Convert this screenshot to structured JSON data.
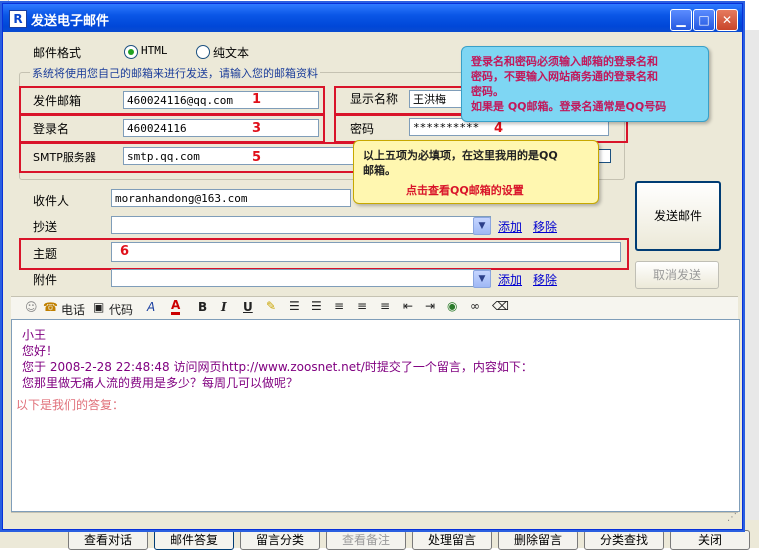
{
  "window": {
    "title": "发送电子邮件",
    "app_icon": "R",
    "controls": [
      "minimize-icon",
      "maximize-icon",
      "close-icon"
    ]
  },
  "format": {
    "label": "邮件格式",
    "option_html": "HTML",
    "option_text": "纯文本",
    "selected": "HTML"
  },
  "group_title": "系统将使用您自己的邮箱来进行发送，请输入您的邮箱资料",
  "fields": {
    "sender_label": "发件邮箱",
    "sender_value": "460024116@qq.com",
    "login_label": "登录名",
    "login_value": "460024116",
    "smtp_label": "SMTP服务器",
    "smtp_value": "smtp.qq.com",
    "display_label": "显示名称",
    "display_value": "王洪梅",
    "password_label": "密码",
    "password_value": "**********"
  },
  "numbers": [
    "1",
    "2",
    "3",
    "4",
    "5",
    "6"
  ],
  "recipients": {
    "to_label": "收件人",
    "to_value": "moranhandong@163.com",
    "cc_label": "抄送",
    "subject_label": "主题",
    "attach_label": "附件",
    "add_link": "添加",
    "remove_link": "移除"
  },
  "buttons": {
    "send": "发送邮件",
    "cancel": "取消发送"
  },
  "tooltip_blue": {
    "line1": "登录名和密码必须输入邮箱的登录名和",
    "line2": "密码，不要输入网站商务通的登录名和",
    "line3": "密码。",
    "line4": "如果是 QQ邮箱。登录名通常是QQ号码"
  },
  "tooltip_yellow": {
    "line1": "以上五项为必填项，在这里我用的是QQ",
    "line2": "邮箱。",
    "link": "点击查看QQ邮箱的设置"
  },
  "toolbar": {
    "phone": "电话",
    "code": "代码"
  },
  "body": {
    "line1": "小王",
    "line2": "您好！",
    "line3": "您于  2008-2-28 22:48:48 访问网页http://www.zoosnet.net/时提交了一个留言，内容如下：",
    "line4": "您那里做无痛人流的费用是多少？每周几可以做呢？",
    "line5": "以下是我们的答复："
  },
  "bottom_buttons": [
    "查看对话",
    "邮件答复",
    "留言分类",
    "查看备注",
    "处理留言",
    "删除留言",
    "分类查找",
    "关闭"
  ],
  "colors": {
    "title_bar": "#0a56e6",
    "annotation_red": "#d9142a",
    "body_purple": "#800080",
    "reply_pink": "#e0707a"
  }
}
